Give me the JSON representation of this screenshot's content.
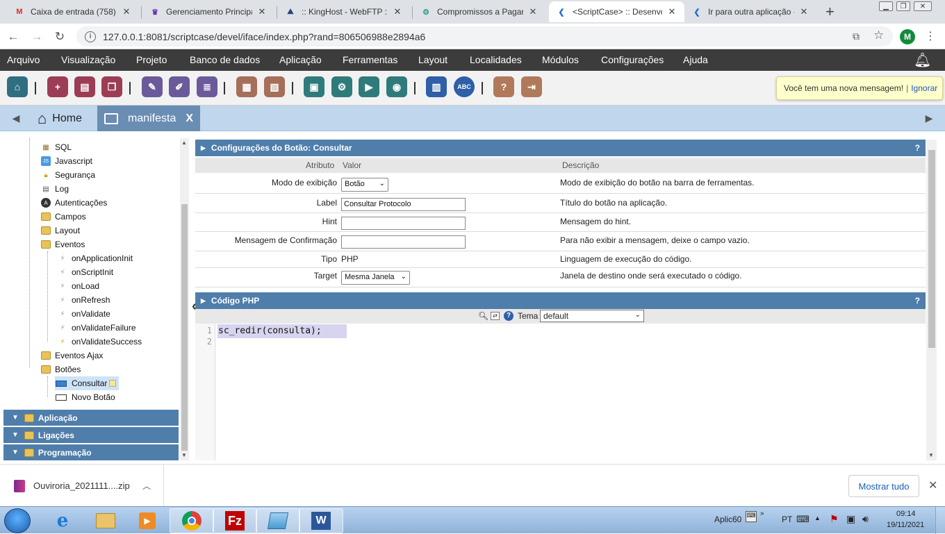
{
  "browser": {
    "tabs": [
      {
        "title": "Caixa de entrada (758) -",
        "icon": "gmail-icon"
      },
      {
        "title": "Gerenciamento Principal",
        "icon": "crown-icon"
      },
      {
        "title": ":: KingHost - WebFTP ::",
        "icon": "kinghost-icon"
      },
      {
        "title": "Compromissos a Pagar -",
        "icon": "gear-icon"
      },
      {
        "title": "<ScriptCase> :: Desenvo",
        "icon": "scriptcase-icon"
      },
      {
        "title": "Ir para outra aplicação -",
        "icon": "scriptcase-icon"
      }
    ],
    "url": "127.0.0.1:8081/scriptcase/devel/iface/index.php?rand=806506988e2894a6",
    "avatar_letter": "M"
  },
  "menu": [
    "Arquivo",
    "Visualização",
    "Projeto",
    "Banco de dados",
    "Aplicação",
    "Ferramentas",
    "Layout",
    "Localidades",
    "Módulos",
    "Configurações",
    "Ajuda"
  ],
  "notification": {
    "message": "Você tem uma nova mensagem!",
    "separator": "|",
    "dismiss": "Ignorar"
  },
  "tabs": {
    "home": "Home",
    "current": "manifesta",
    "close": "X"
  },
  "tree": {
    "items": [
      {
        "label": "SQL",
        "icon": "sql-icon"
      },
      {
        "label": "Javascript",
        "icon": "js-icon"
      },
      {
        "label": "Segurança",
        "icon": "lock-icon"
      },
      {
        "label": "Log",
        "icon": "log-icon"
      },
      {
        "label": "Autenticações",
        "icon": "auth-icon"
      },
      {
        "label": "Campos",
        "icon": "folder-icon"
      },
      {
        "label": "Layout",
        "icon": "folder-icon"
      },
      {
        "label": "Eventos",
        "icon": "folder-icon"
      },
      {
        "label": "onApplicationInit",
        "icon": "event-icon"
      },
      {
        "label": "onScriptInit",
        "icon": "event-icon"
      },
      {
        "label": "onLoad",
        "icon": "event-icon"
      },
      {
        "label": "onRefresh",
        "icon": "event-icon"
      },
      {
        "label": "onValidate",
        "icon": "event-icon"
      },
      {
        "label": "onValidateFailure",
        "icon": "event-icon"
      },
      {
        "label": "onValidateSuccess",
        "icon": "event-active-icon"
      },
      {
        "label": "Eventos Ajax",
        "icon": "folder-icon"
      },
      {
        "label": "Botões",
        "icon": "folder-icon"
      },
      {
        "label": "Consultar",
        "icon": "button-icon"
      },
      {
        "label": "Novo Botão",
        "icon": "button-outline-icon"
      }
    ],
    "sections": [
      "Aplicação",
      "Ligações",
      "Programação"
    ]
  },
  "button_config": {
    "title": "Configurações do Botão: Consultar",
    "help": "?",
    "columns": {
      "attribute": "Atributo",
      "value": "Valor",
      "description": "Descrição"
    },
    "rows": [
      {
        "label": "Modo de exibição",
        "value": "Botão",
        "type": "select",
        "description": "Modo de exibição do botão na barra de ferramentas."
      },
      {
        "label": "Label",
        "value": "Consultar Protocolo",
        "type": "text",
        "description": "Título do botão na aplicação."
      },
      {
        "label": "Hint",
        "value": "",
        "type": "text",
        "description": "Mensagem do hint."
      },
      {
        "label": "Mensagem de Confirmação",
        "value": "",
        "type": "text",
        "description": "Para não exibir a mensagem, deixe o campo vazio."
      },
      {
        "label": "Tipo",
        "value": "PHP",
        "type": "static",
        "description": "Linguagem de execução do código."
      },
      {
        "label": "Target",
        "value": "Mesma Janela",
        "type": "select",
        "description": "Janela de destino onde será executado o código."
      }
    ]
  },
  "code_section": {
    "title": "Código PHP",
    "help": "?",
    "theme_label": "Tema",
    "theme_value": "default",
    "lines": [
      "sc_redir(consulta);",
      ""
    ],
    "line_numbers": [
      "1",
      "2"
    ]
  },
  "download": {
    "filename": "Ouviroria_2021111....zip",
    "show_all": "Mostrar tudo"
  },
  "taskbar": {
    "apps": [
      "ie-icon",
      "explorer-icon",
      "media-icon",
      "chrome-icon",
      "filezilla-icon",
      "notepad-icon",
      "word-icon"
    ],
    "tray_text": "Aplic60",
    "language": "PT",
    "time": "09:14",
    "date": "19/11/2021"
  },
  "colors": {
    "header_blue": "#4f7eab",
    "menu_dark": "#3c3c3c",
    "tab_active": "#6a8db3",
    "notif_bg": "#ffffcc"
  }
}
